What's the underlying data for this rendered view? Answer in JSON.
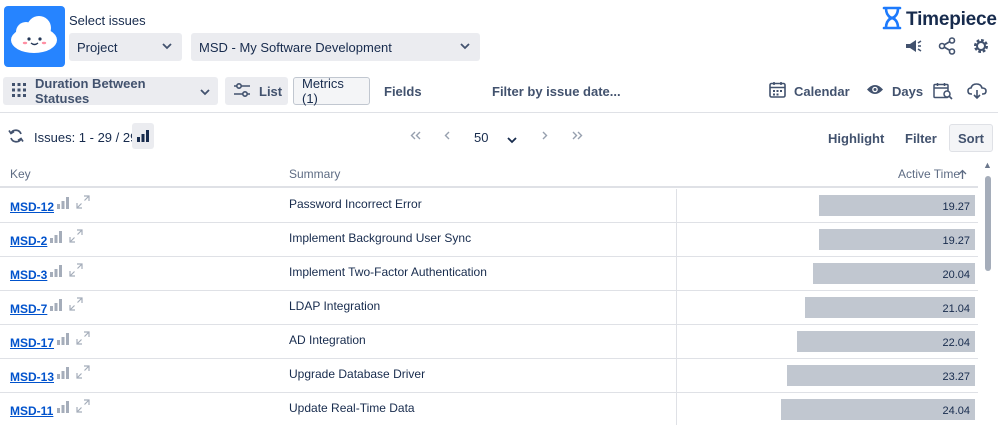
{
  "header": {
    "select_label": "Select issues",
    "project_select": "Project",
    "project_value": "MSD - My Software Development",
    "brand": "Timepiece"
  },
  "toolbar": {
    "report_type": "Duration Between Statuses",
    "list": "List",
    "metrics": "Metrics (1)",
    "fields": "Fields",
    "filter_date": "Filter by issue date...",
    "calendar": "Calendar",
    "days": "Days"
  },
  "pager": {
    "issues": "Issues: 1 - 29 / 29",
    "page_size": "50",
    "highlight": "Highlight",
    "filter": "Filter",
    "sort": "Sort"
  },
  "table": {
    "headers": {
      "key": "Key",
      "summary": "Summary",
      "active_time": "Active Time"
    },
    "max_value": 24.04,
    "rows": [
      {
        "key": "MSD-12",
        "summary": "Password Incorrect Error",
        "value": "19.27"
      },
      {
        "key": "MSD-2",
        "summary": "Implement Background User Sync",
        "value": "19.27"
      },
      {
        "key": "MSD-3",
        "summary": "Implement Two-Factor Authentication",
        "value": "20.04"
      },
      {
        "key": "MSD-7",
        "summary": "LDAP Integration",
        "value": "21.04"
      },
      {
        "key": "MSD-17",
        "summary": "AD Integration",
        "value": "22.04"
      },
      {
        "key": "MSD-13",
        "summary": "Upgrade Database Driver",
        "value": "23.27"
      },
      {
        "key": "MSD-11",
        "summary": "Update Real-Time Data",
        "value": "24.04"
      }
    ]
  },
  "colors": {
    "accent": "#2684ff",
    "link": "#0052cc",
    "bar": "#c1c7d0"
  }
}
